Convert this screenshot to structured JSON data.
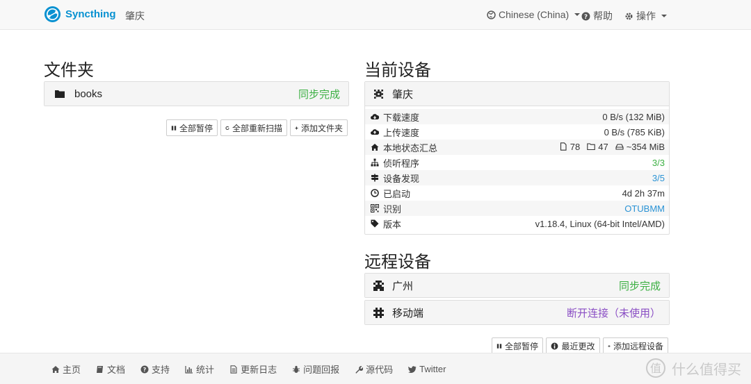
{
  "navbar": {
    "brand": "Syncthing",
    "device": "肇庆",
    "language": "Chinese (China)",
    "help": "帮助",
    "actions": "操作"
  },
  "folders": {
    "heading": "文件夹",
    "items": [
      {
        "name": "books",
        "status": "同步完成"
      }
    ],
    "buttons": {
      "pause_all": "全部暂停",
      "rescan_all": "全部重新扫描",
      "add_folder": "添加文件夹"
    }
  },
  "this_device": {
    "heading": "当前设备",
    "name": "肇庆",
    "rows": [
      {
        "label": "下载速度",
        "value": "0 B/s (132 MiB)",
        "icon": "cloud-download-icon"
      },
      {
        "label": "上传速度",
        "value": "0 B/s (785 KiB)",
        "icon": "cloud-upload-icon"
      },
      {
        "label": "本地状态汇总",
        "files": "78",
        "dirs": "47",
        "size": "~354 MiB",
        "icon": "home-icon"
      },
      {
        "label": "侦听程序",
        "value": "3/3",
        "icon": "sitemap-icon"
      },
      {
        "label": "设备发现",
        "value": "3/5",
        "icon": "signpost-icon"
      },
      {
        "label": "已启动",
        "value": "4d 2h 37m",
        "icon": "clock-icon"
      },
      {
        "label": "识别",
        "value": "OTUBMM",
        "icon": "qrcode-icon"
      },
      {
        "label": "版本",
        "value": "v1.18.4, Linux (64-bit Intel/AMD)",
        "icon": "tag-icon"
      }
    ]
  },
  "remote_devices": {
    "heading": "远程设备",
    "items": [
      {
        "name": "广州",
        "status": "同步完成"
      },
      {
        "name": "移动端",
        "status": "断开连接（未使用）"
      }
    ],
    "buttons": {
      "pause_all": "全部暂停",
      "recent_changes": "最近更改",
      "add_remote": "添加远程设备"
    }
  },
  "footer": {
    "links": [
      "主页",
      "文档",
      "支持",
      "统计",
      "更新日志",
      "问题回报",
      "源代码",
      "Twitter"
    ],
    "watermark": "什么值得买"
  },
  "colors": {
    "brand": "#0891d1",
    "status_ok": "#3cb043",
    "status_disconnected": "#8a4ec4",
    "link_blue": "#2a93d5"
  }
}
